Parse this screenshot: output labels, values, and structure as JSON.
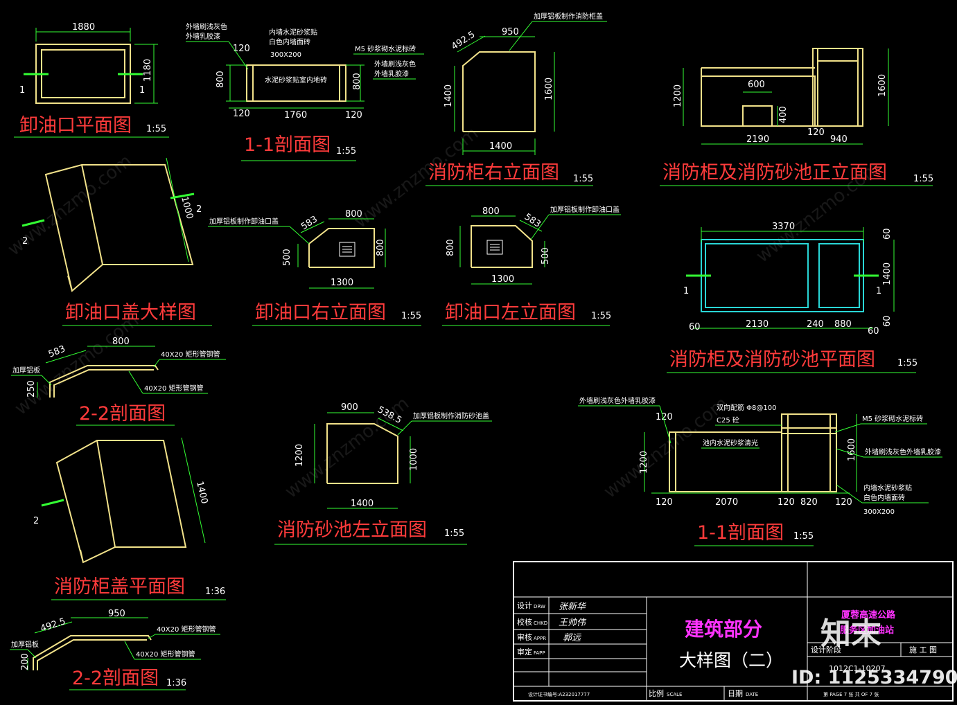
{
  "drawings": {
    "plan_outlet": {
      "title": "卸油口平面图",
      "scale": "1:55",
      "dims": [
        "1880",
        "1180"
      ],
      "marks": [
        "1",
        "1"
      ]
    },
    "section_1_1_a": {
      "title": "1-1剖面图",
      "scale": "1:55",
      "dims": [
        "120",
        "800",
        "1760",
        "120",
        "800",
        "120",
        "120"
      ],
      "notes": [
        "外墙刷浅灰色",
        "外墙乳胶漆",
        "内墙水泥砂浆贴",
        "白色内墙面砖",
        "300X200",
        "M5 砂浆砌水泥标砖",
        "外墙刷浅灰色",
        "外墙乳胶漆",
        "水泥砂浆贴室内地砖"
      ]
    },
    "cabinet_right": {
      "title": "消防柜右立面图",
      "scale": "1:55",
      "dims": [
        "492.5",
        "950",
        "1400",
        "1600",
        "1400"
      ],
      "notes": [
        "加厚铝板制作消防柜盖"
      ]
    },
    "cabinet_front": {
      "title": "消防柜及消防砂池正立面图",
      "scale": "1:55",
      "dims": [
        "600",
        "1200",
        "400",
        "1600",
        "2190",
        "120",
        "940"
      ]
    },
    "outlet_cover": {
      "title": "卸油口盖大样图",
      "dims": [
        "1000"
      ],
      "marks": [
        "2",
        "2"
      ]
    },
    "outlet_right": {
      "title": "卸油口右立面图",
      "scale": "1:55",
      "dims": [
        "583",
        "800",
        "500",
        "800",
        "1300"
      ],
      "notes": [
        "加厚铝板制作卸油口盖"
      ]
    },
    "outlet_left": {
      "title": "卸油口左立面图",
      "scale": "1:55",
      "dims": [
        "800",
        "583",
        "800",
        "500",
        "1300"
      ],
      "notes": [
        "加厚铝板制作卸油口盖"
      ]
    },
    "cabinet_plan": {
      "title": "消防柜及消防砂池平面图",
      "scale": "1:55",
      "dims": [
        "3370",
        "60",
        "1400",
        "60",
        "60",
        "2130",
        "240",
        "880",
        "60"
      ],
      "marks": [
        "1",
        "1"
      ]
    },
    "section_2_2_a": {
      "title": "2-2剖面图",
      "dims": [
        "583",
        "800",
        "250"
      ],
      "notes": [
        "40X20 矩形管钢管",
        "加厚铝板",
        "40X20 矩形管钢管"
      ]
    },
    "sand_left": {
      "title": "消防砂池左立面图",
      "scale": "1:55",
      "dims": [
        "900",
        "538.5",
        "1200",
        "1000",
        "1400"
      ],
      "notes": [
        "加厚铝板制作消防砂池盖"
      ]
    },
    "section_1_1_b": {
      "title": "1-1剖面图",
      "scale": "1:55",
      "dims": [
        "120",
        "1200",
        "120",
        "2070",
        "120",
        "820",
        "120",
        "1600"
      ],
      "notes": [
        "外墙刷浅灰色外墙乳胶漆",
        "双向配筋 Φ8@100",
        "C25 砼",
        "M5 砂浆砌水泥标砖",
        "池内水泥砂浆清光",
        "外墙刷浅灰色外墙乳胶漆",
        "内墙水泥砂浆贴",
        "白色内墙面砖",
        "300X200"
      ]
    },
    "cabinet_cover": {
      "title": "消防柜盖平面图",
      "scale": "1:36",
      "dims": [
        "1400"
      ],
      "marks": [
        "2"
      ]
    },
    "section_2_2_b": {
      "title": "2-2剖面图",
      "scale": "1:36",
      "dims": [
        "492.5",
        "950",
        "200"
      ],
      "notes": [
        "40X20 矩形管钢管",
        "加厚铝板",
        "40X20 矩形管钢管"
      ]
    }
  },
  "title_block": {
    "rows": [
      {
        "label": "设计",
        "code": "DRW",
        "sign": "张新华"
      },
      {
        "label": "校核",
        "code": "CHKD",
        "sign": "王帅伟"
      },
      {
        "label": "审核",
        "code": "APPR",
        "sign": "郭远"
      },
      {
        "label": "审定",
        "code": "FAPP",
        "sign": ""
      }
    ],
    "cert": "设计证书编号:A232017777",
    "section": "建筑部分",
    "drawing_name": "大样图（二）",
    "project_line1": "厦蓉高速公路",
    "project_line2": "服务区加油站",
    "stage_label": "设计阶段",
    "stage_value": "施 工 图",
    "drawing_no": "1012C1-10207",
    "scale_label": "比例",
    "scale_code": "SCALE",
    "date_label": "日期",
    "date_code": "DATE",
    "page_label": "第 PAGE 7 张 共 OF 7 张"
  },
  "watermark": {
    "brand": "知末",
    "site": "www.znzmo.com",
    "site_cn": "知末网",
    "id": "ID: 1125334790"
  },
  "colors": {
    "title": "#ff3b3b",
    "outline": "#f2e28a",
    "dimension": "#33ff33",
    "cyan": "#29d7d7",
    "magenta": "#ff33ff",
    "background": "#000000"
  }
}
